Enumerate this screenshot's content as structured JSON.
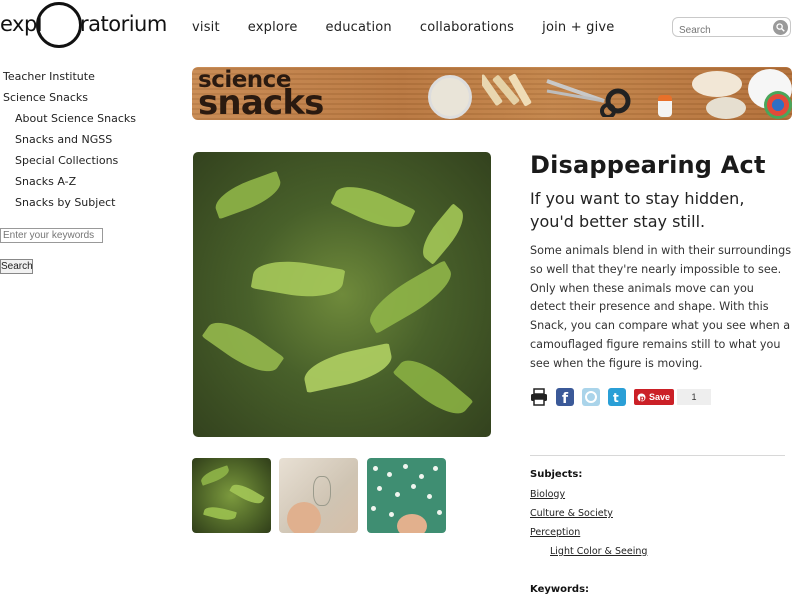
{
  "header": {
    "logo_left": "expl",
    "logo_right": "ratorium",
    "nav": [
      "visit",
      "explore",
      "education",
      "collaborations",
      "join + give"
    ],
    "search_placeholder": "Search"
  },
  "sidebar": {
    "items": [
      {
        "label": "Teacher Institute",
        "level": 1
      },
      {
        "label": "Science Snacks",
        "level": 1
      },
      {
        "label": "About Science Snacks",
        "level": 2
      },
      {
        "label": "Snacks and NGSS",
        "level": 2
      },
      {
        "label": "Special Collections",
        "level": 2
      },
      {
        "label": "Snacks A-Z",
        "level": 2
      },
      {
        "label": "Snacks by Subject",
        "level": 2
      }
    ],
    "keyword_placeholder": "Enter your keywords",
    "search_button": "Search"
  },
  "banner": {
    "line1": "science",
    "line2": "snacks"
  },
  "article": {
    "title": "Disappearing Act",
    "subtitle": "If you want to stay hidden, you'd better stay still.",
    "description": "Some animals blend in with their surroundings so well that they're nearly impossible to see. Only when these animals move can you detect their presence and shape. With this Snack, you can compare what you see when a camouflaged figure remains still to what you see when the figure is moving.",
    "share": {
      "icons": [
        "print-icon",
        "facebook-icon",
        "delicious-icon",
        "twitter-icon"
      ],
      "save_label": "Save",
      "save_count": "1"
    },
    "subjects_heading": "Subjects:",
    "subjects": [
      "Biology",
      "Culture & Society",
      "Perception",
      "Light Color & Seeing"
    ],
    "keywords_heading": "Keywords:"
  },
  "colors": {
    "pinterest": "#cb2027",
    "facebook": "#3b5998",
    "twitter": "#2a9fd6",
    "banner": "#b9773f"
  }
}
